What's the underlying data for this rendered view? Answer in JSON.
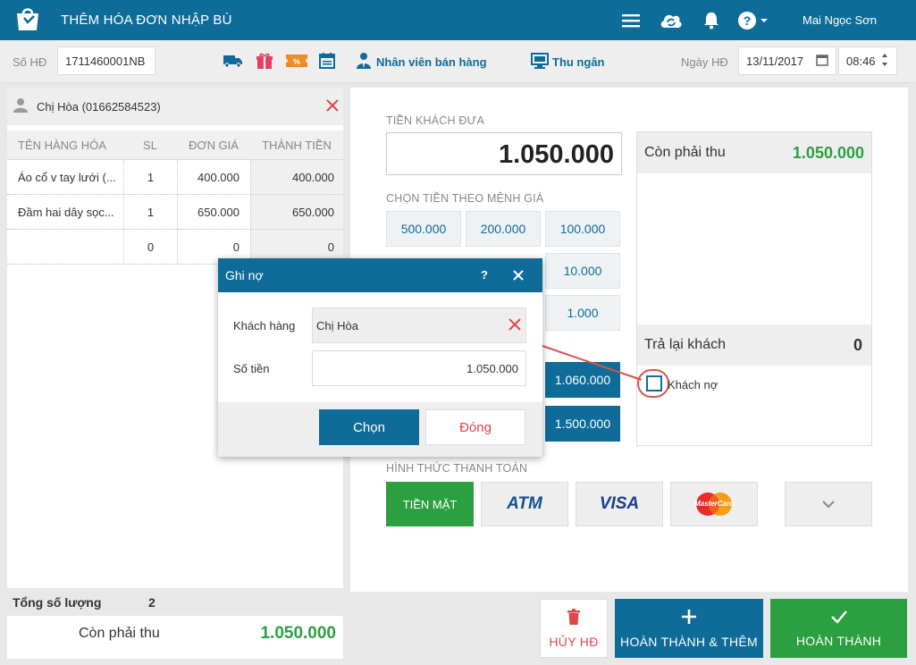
{
  "header": {
    "title": "THÊM HÓA ĐƠN NHẬP BÙ",
    "user": "Mai Ngọc Sơn",
    "icons": [
      "shop-logo-icon",
      "menu-icon",
      "cloud-sync-icon",
      "bell-icon",
      "help-icon"
    ]
  },
  "toolbar": {
    "invoice_label": "Số HĐ",
    "invoice_value": "1711460001NB",
    "staff_label": "Nhân viên bán hàng",
    "cashier_label": "Thu ngân",
    "date_label": "Ngày HĐ",
    "date_value": "13/11/2017",
    "time_value": "08:46"
  },
  "customer": {
    "name": "Chị Hòa (01662584523)"
  },
  "grid": {
    "headers": [
      "TÊN HÀNG HÓA",
      "SL",
      "ĐƠN GIÁ",
      "THÀNH TIỀN"
    ],
    "rows": [
      [
        "Áo cổ v tay lưới (...",
        "1",
        "400.000",
        "400.000"
      ],
      [
        "Đầm hai dây sọc...",
        "1",
        "650.000",
        "650.000"
      ],
      [
        "",
        "0",
        "0",
        "0"
      ]
    ]
  },
  "totals": {
    "qty_label": "Tổng số lượng",
    "qty_value": "2",
    "remain_label": "Còn phải thu",
    "remain_value": "1.050.000"
  },
  "payment": {
    "given_label": "TIỀN KHÁCH ĐƯA",
    "given_value": "1.050.000",
    "denom_label": "CHỌN TIỀN THEO MỆNH GIÁ",
    "denoms": [
      "500.000",
      "200.000",
      "100.000",
      "10.000",
      "1.000",
      "1.060.000",
      "1.500.000"
    ],
    "remain_label": "Còn phải thu",
    "remain_value": "1.050.000",
    "change_label": "Trả lại khách",
    "change_value": "0",
    "debt_label": "Khách nợ",
    "method_label": "HÌNH THỨC THANH TOÁN",
    "cash_label": "TIỀN MẶT",
    "atm_label": "ATM",
    "visa_label": "VISA",
    "mastercard_label": "MasterCard"
  },
  "actions": {
    "cancel_label": "HỦY HĐ",
    "complete_add_label": "HOÀN THÀNH & THÊM",
    "complete_label": "HOÀN THÀNH"
  },
  "modal": {
    "title": "Ghi nợ",
    "help": "?",
    "customer_label": "Khách hàng",
    "customer_value": "Chị Hòa",
    "amount_label": "Số tiền",
    "amount_value": "1.050.000",
    "choose_label": "Chọn",
    "close_label": "Đóng"
  },
  "colors": {
    "primary": "#0f6c99",
    "green": "#2c9f41",
    "danger": "#e04848",
    "annotation": "#d9534f"
  }
}
